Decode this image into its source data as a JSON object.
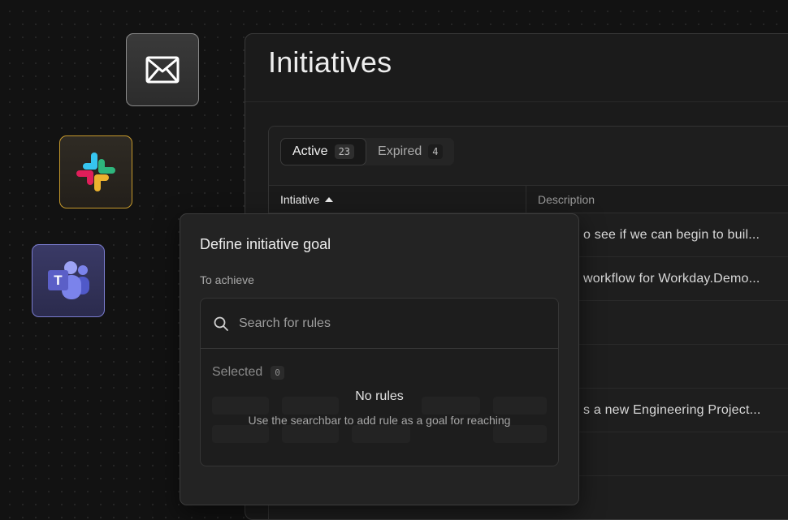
{
  "integrations": [
    {
      "name": "email",
      "icon": "envelope-icon"
    },
    {
      "name": "slack",
      "icon": "slack-icon"
    },
    {
      "name": "teams",
      "icon": "teams-icon"
    }
  ],
  "page": {
    "title": "Initiatives",
    "tabs": [
      {
        "label": "Active",
        "count": "23"
      },
      {
        "label": "Expired",
        "count": "4"
      }
    ],
    "table": {
      "columns": [
        "Intiative",
        "Description"
      ],
      "rows": [
        {
          "description": "o see if we can begin to buil..."
        },
        {
          "description": "workflow for Workday.Demo..."
        },
        {
          "description": ""
        },
        {
          "description": ""
        },
        {
          "description": "s a new Engineering Project..."
        },
        {
          "description": ""
        }
      ]
    }
  },
  "modal": {
    "title": "Define initiative goal",
    "achieve_label": "To achieve",
    "search_placeholder": "Search for rules",
    "selected_label": "Selected",
    "selected_count": "0",
    "empty_title": "No rules",
    "empty_subtitle": "Use the searchbar to add rule as a goal for reaching"
  },
  "colors": {
    "background": "#121212",
    "slack_border": "#c79a2c",
    "teams_border": "#7a7ccf",
    "teams_purple": "#5b5fc7"
  }
}
